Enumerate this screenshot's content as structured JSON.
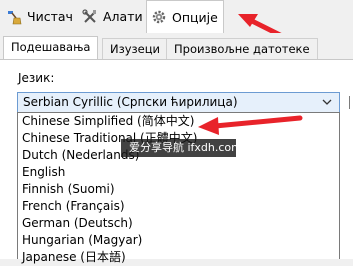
{
  "top_tabs": [
    {
      "label": "Чистач",
      "icon": "broom-icon"
    },
    {
      "label": "Алати",
      "icon": "tools-icon"
    },
    {
      "label": "Опције",
      "icon": "gear-icon"
    }
  ],
  "sub_tabs": [
    "Подешавања",
    "Изузеци",
    "Произвољне датотеке"
  ],
  "language": {
    "label": "Језик:",
    "selected": "Serbian Cyrillic (Српски ћирилица)",
    "options": [
      "Chinese Simplified (简体中文)",
      "Chinese Traditional (正體中文)",
      "Dutch (Nederlands)",
      "English",
      "Finnish (Suomi)",
      "French (Français)",
      "German (Deutsch)",
      "Hungarian (Magyar)",
      "Japanese (日本語)"
    ]
  },
  "watermark": "爱分享导航 ifxdh.com",
  "colors": {
    "arrow": "#e8232a",
    "selection": "#e6f0fb",
    "focus_border": "#6c9bd2"
  }
}
